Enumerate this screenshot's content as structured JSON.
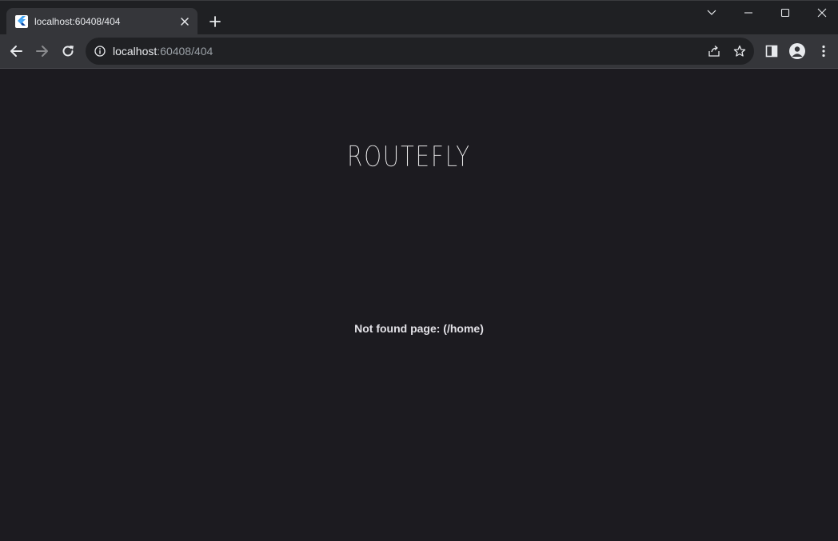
{
  "browser": {
    "tab": {
      "title": "localhost:60408/404",
      "favicon": "flutter-icon"
    },
    "address_bar": {
      "host": "localhost",
      "path": ":60408/404"
    },
    "window_controls": [
      "chevron-down-icon",
      "minimize-icon",
      "maximize-icon",
      "close-icon"
    ],
    "toolbar_icons": [
      "back-arrow-icon",
      "forward-arrow-icon",
      "reload-icon",
      "info-icon",
      "share-icon",
      "star-icon",
      "side-panel-icon",
      "profile-icon",
      "more-vert-icon"
    ]
  },
  "page": {
    "logo_text": "ROUTEFLY",
    "message": "Not found page: (/home)"
  },
  "colors": {
    "page_background": "#1c1b20",
    "toolbar": "#35363a",
    "tabstrip": "#1f2023",
    "omnibox": "#202124",
    "flutter_blue": "#42a5f5"
  }
}
